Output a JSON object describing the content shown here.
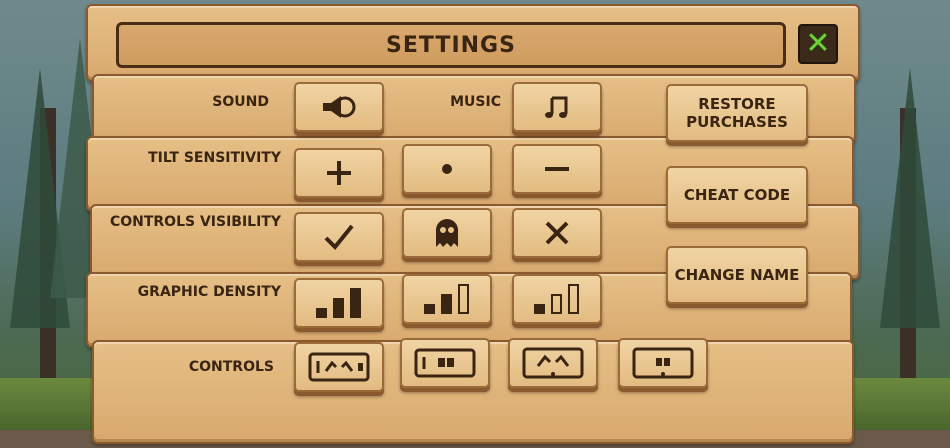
{
  "title": "SETTINGS",
  "close_icon": "close-icon",
  "rows": {
    "sound": "SOUND",
    "music": "MUSIC",
    "tilt": "TILT SENSITIVITY",
    "controls_visibility": "CONTROLS VISIBILITY",
    "graphic_density": "GRAPHIC DENSITY",
    "controls": "CONTROLS"
  },
  "buttons": {
    "restore": "RESTORE PURCHASES",
    "cheat": "CHEAT CODE",
    "change_name": "CHANGE NAME"
  },
  "colors": {
    "close_accent": "#6fd13a",
    "text": "#3a2412",
    "wood": "#e6bf86"
  }
}
